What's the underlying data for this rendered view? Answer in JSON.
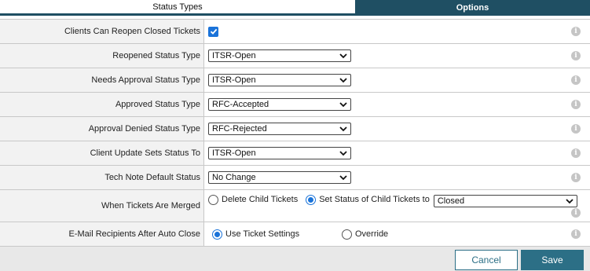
{
  "tabs": [
    {
      "label": "Status Types",
      "active": false
    },
    {
      "label": "Options",
      "active": true
    }
  ],
  "form": {
    "reopen_label": "Clients Can Reopen Closed Tickets",
    "reopen_checked": true,
    "reopened_label": "Reopened Status Type",
    "reopened_value": "ITSR-Open",
    "needs_approval_label": "Needs Approval Status Type",
    "needs_approval_value": "ITSR-Open",
    "approved_label": "Approved Status Type",
    "approved_value": "RFC-Accepted",
    "denied_label": "Approval Denied Status Type",
    "denied_value": "RFC-Rejected",
    "client_update_label": "Client Update Sets Status To",
    "client_update_value": "ITSR-Open",
    "tech_note_label": "Tech Note Default Status",
    "tech_note_value": "No Change",
    "merged_label": "When Tickets Are Merged",
    "merged_option_delete": "Delete Child Tickets",
    "merged_option_set": "Set Status of Child Tickets to",
    "merged_selected": "set",
    "merged_status_value": "Closed",
    "email_label": "E-Mail Recipients After Auto Close",
    "email_option_ticket": "Use Ticket Settings",
    "email_option_override": "Override",
    "email_selected": "ticket"
  },
  "footer": {
    "cancel_label": "Cancel",
    "save_label": "Save"
  },
  "colors": {
    "accent": "#1f4f63",
    "button": "#2c6f86",
    "check": "#1a73d9"
  },
  "icons": {
    "info": "info-icon",
    "chevron": "chevron-down-icon",
    "check": "checkmark-icon"
  }
}
